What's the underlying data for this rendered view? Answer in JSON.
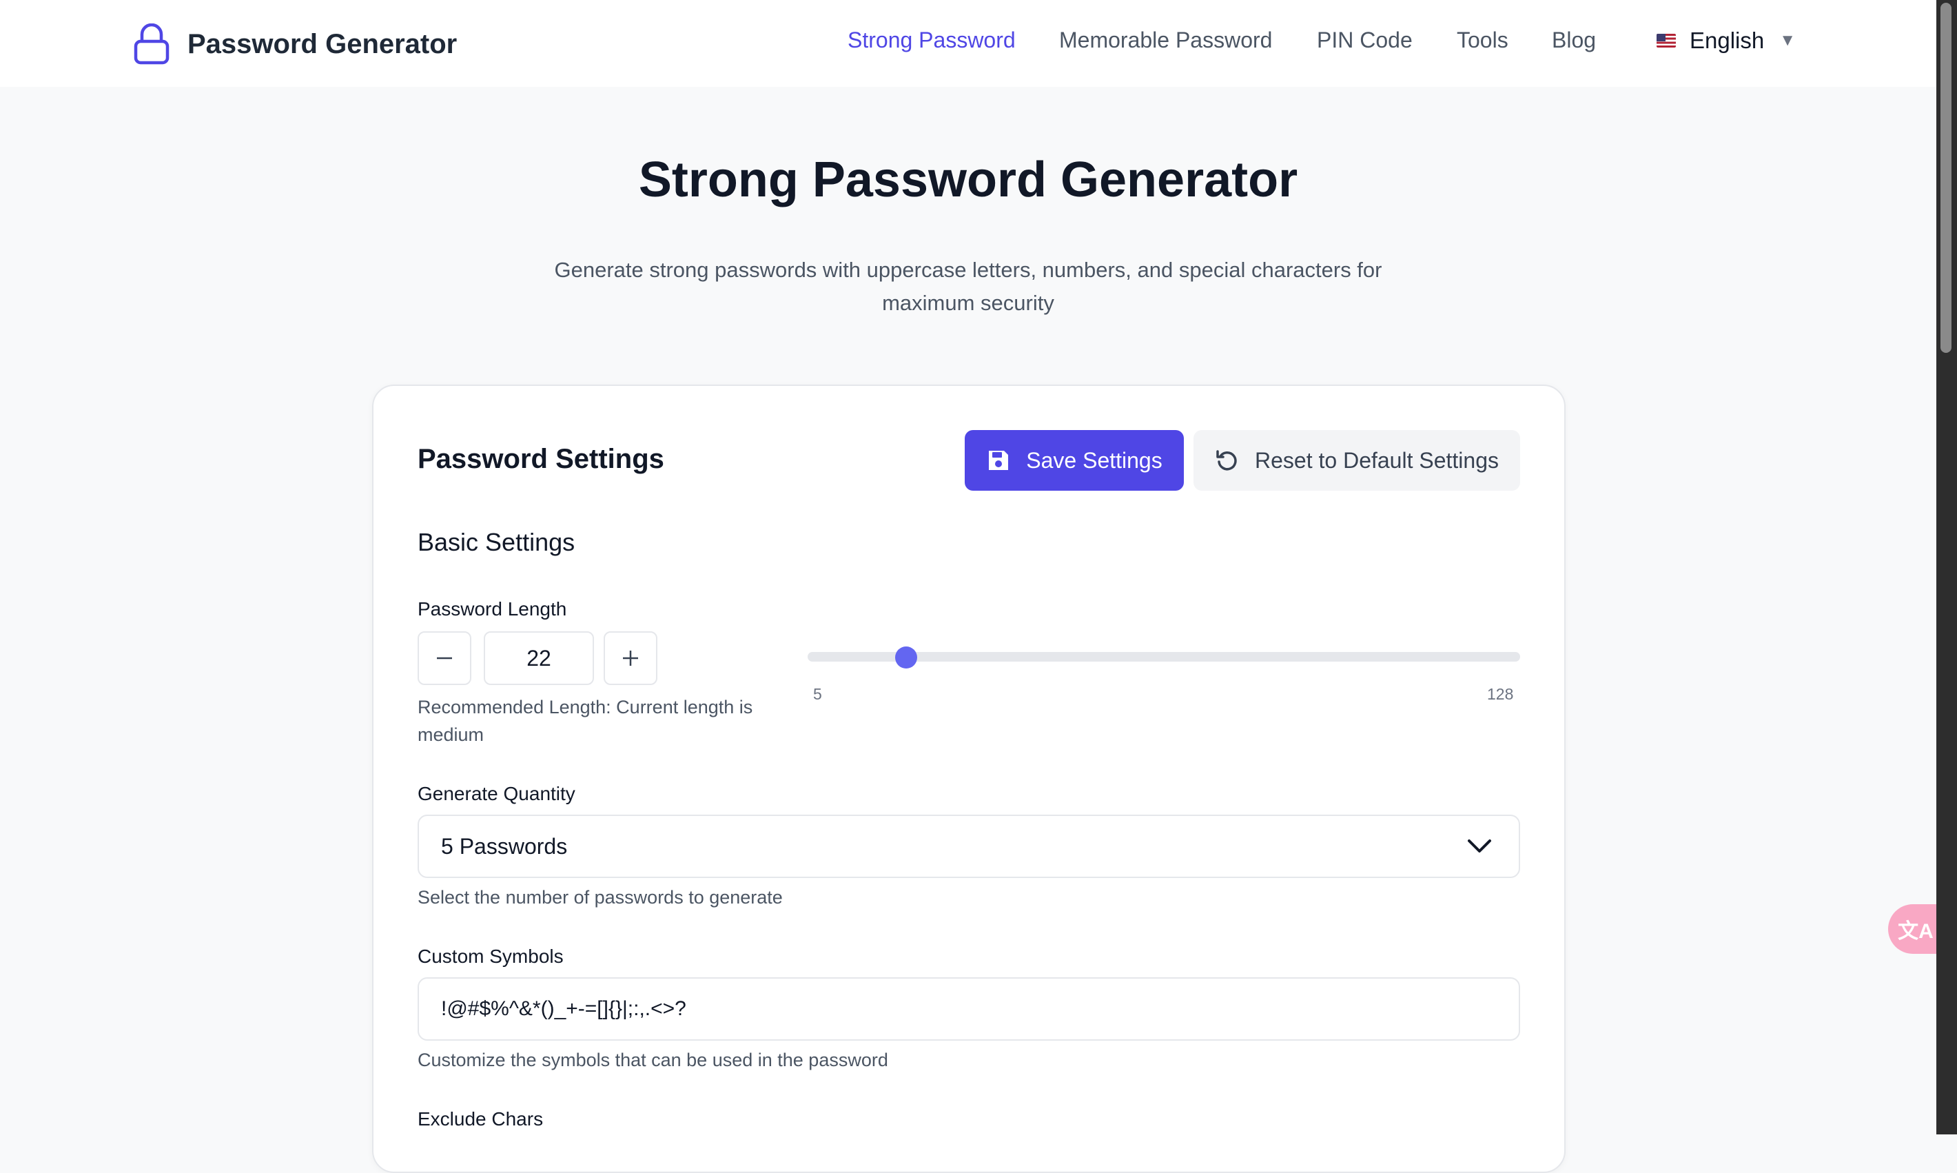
{
  "header": {
    "logo_text": "Password Generator",
    "nav": [
      {
        "label": "Strong Password",
        "active": true
      },
      {
        "label": "Memorable Password",
        "active": false
      },
      {
        "label": "PIN Code",
        "active": false
      },
      {
        "label": "Tools",
        "active": false
      },
      {
        "label": "Blog",
        "active": false
      }
    ],
    "language": {
      "label": "English",
      "flag": "us-flag-icon"
    }
  },
  "hero": {
    "title": "Strong Password Generator",
    "subtitle": "Generate strong passwords with uppercase letters, numbers, and special characters for maximum security"
  },
  "settings": {
    "title": "Password Settings",
    "save_label": "Save Settings",
    "reset_label": "Reset to Default Settings",
    "section_basic": "Basic Settings",
    "length": {
      "label": "Password Length",
      "value": "22",
      "min": 5,
      "max": 128,
      "min_label": "5",
      "max_label": "128",
      "hint": "Recommended Length: Current length is medium"
    },
    "quantity": {
      "label": "Generate Quantity",
      "selected": "5 Passwords",
      "hint": "Select the number of passwords to generate"
    },
    "custom_symbols": {
      "label": "Custom Symbols",
      "value": "!@#$%^&*()_+-=[]{}|;:,.<>?",
      "hint": "Customize the symbols that can be used in the password"
    },
    "exclude_chars": {
      "label": "Exclude Chars"
    }
  },
  "colors": {
    "accent": "#4f46e5",
    "slider": "#6366f1",
    "background": "#f8f9fa"
  },
  "icons": {
    "logo": "lock-icon",
    "save": "save-icon",
    "reset": "reset-icon",
    "select": "chevron-down-icon",
    "translate": "translate-icon"
  },
  "translate_fab": {
    "glyph": "文A"
  }
}
